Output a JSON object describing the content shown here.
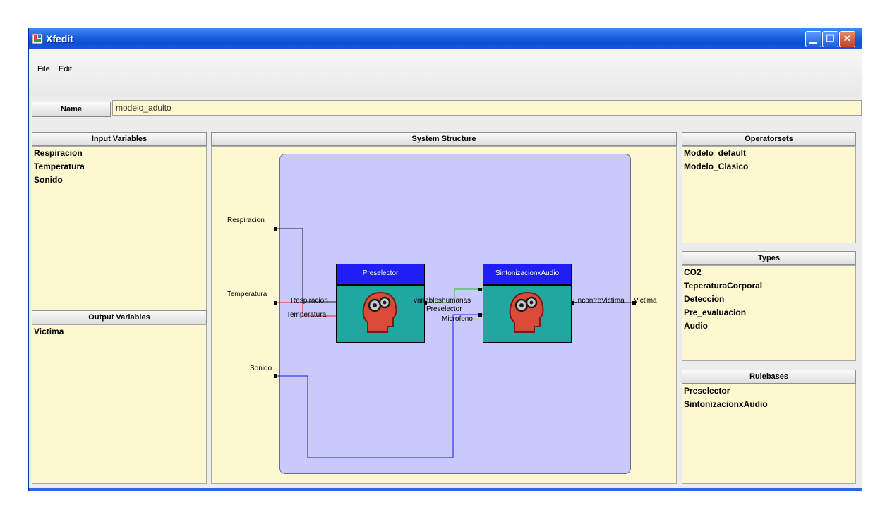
{
  "window": {
    "title": "Xfedit"
  },
  "menu": [
    {
      "label": "File"
    },
    {
      "label": "Edit"
    }
  ],
  "name_field": {
    "label": "Name",
    "value": "modelo_adulto"
  },
  "input_variables": {
    "title": "Input Variables",
    "items": [
      "Respiracion",
      "Temperatura",
      "Sonido"
    ]
  },
  "output_variables": {
    "title": "Output Variables",
    "items": [
      "Victima"
    ]
  },
  "system_structure": {
    "title": "System Structure",
    "inputs": [
      "Respiracion",
      "Temperatura",
      "Sonido"
    ],
    "output": "Victima",
    "modules": [
      {
        "title": "Preselector",
        "in_ports": [
          "Respiracion",
          "Temperatura"
        ],
        "out_port": "variableshumanas"
      },
      {
        "title": "SintonizacionxAudio",
        "in_ports": [
          "Preselector",
          "Microfono"
        ],
        "out_port": "EncontreVictima"
      }
    ]
  },
  "operatorsets": {
    "title": "Operatorsets",
    "items": [
      "Modelo_default",
      "Modelo_Clasico"
    ]
  },
  "types": {
    "title": "Types",
    "items": [
      "CO2",
      "TeperaturaCorporal",
      "Deteccion",
      "Pre_evaluacion",
      "Audio"
    ]
  },
  "rulebases": {
    "title": "Rulebases",
    "items": [
      "Preselector",
      "SintonizacionxAudio"
    ]
  },
  "colors": {
    "title_bar": "#1f61e0",
    "panel_bg": "#fdf8cf",
    "system_bg": "#c9c9fb",
    "module_title": "#1e1ef5",
    "module_body": "#1fa7a0",
    "wire_temp": "#e02020",
    "wire_audio": "#1a1ae0",
    "wire_link": "#20c020"
  }
}
